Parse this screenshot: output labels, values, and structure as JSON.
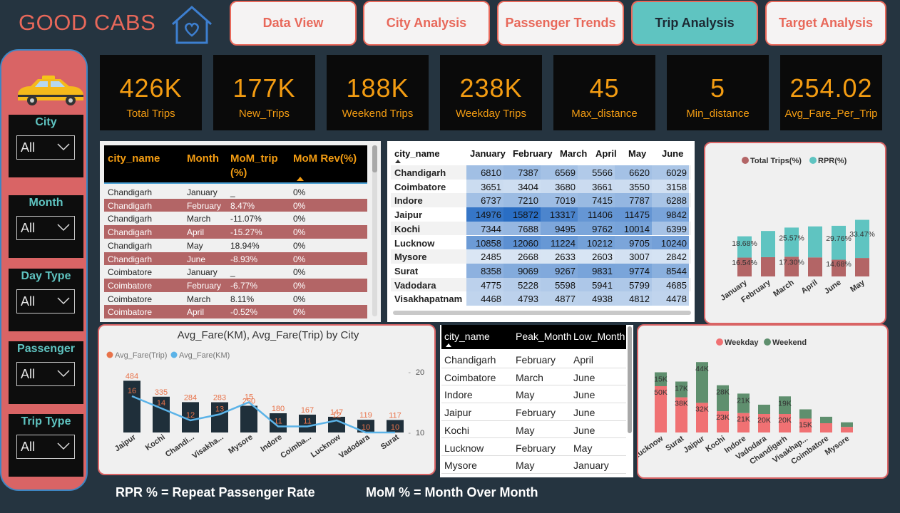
{
  "brand": "GOOD CABS",
  "nav": [
    "Data View",
    "City Analysis",
    "Passenger Trends",
    "Trip Analysis",
    "Target Analysis"
  ],
  "active_nav": "Trip Analysis",
  "filters": [
    {
      "label": "City",
      "value": "All"
    },
    {
      "label": "Month",
      "value": "All"
    },
    {
      "label": "Day Type",
      "value": "All"
    },
    {
      "label": "Passenger",
      "value": "All"
    },
    {
      "label": "Trip Type",
      "value": "All"
    }
  ],
  "kpis": [
    {
      "value": "426K",
      "label": "Total Trips"
    },
    {
      "value": "177K",
      "label": "New_Trips"
    },
    {
      "value": "188K",
      "label": "Weekend Trips"
    },
    {
      "value": "238K",
      "label": "Weekday Trips"
    },
    {
      "value": "45",
      "label": "Max_distance"
    },
    {
      "value": "5",
      "label": "Min_distance"
    },
    {
      "value": "254.02",
      "label": "Avg_Fare_Per_Trip"
    }
  ],
  "mom_table": {
    "headers": [
      "city_name",
      "Month",
      "MoM_trip (%)",
      "MoM Rev(%)"
    ],
    "rows": [
      [
        "Chandigarh",
        "January",
        "_",
        "0%"
      ],
      [
        "Chandigarh",
        "February",
        "8.47%",
        "0%"
      ],
      [
        "Chandigarh",
        "March",
        "-11.07%",
        "0%"
      ],
      [
        "Chandigarh",
        "April",
        "-15.27%",
        "0%"
      ],
      [
        "Chandigarh",
        "May",
        "18.94%",
        "0%"
      ],
      [
        "Chandigarh",
        "June",
        "-8.93%",
        "0%"
      ],
      [
        "Coimbatore",
        "January",
        "_",
        "0%"
      ],
      [
        "Coimbatore",
        "February",
        "-6.77%",
        "0%"
      ],
      [
        "Coimbatore",
        "March",
        "8.11%",
        "0%"
      ],
      [
        "Coimbatore",
        "April",
        "-0.52%",
        "0%"
      ]
    ]
  },
  "heat_table": {
    "headers": [
      "city_name",
      "January",
      "February",
      "March",
      "April",
      "May",
      "June"
    ],
    "rows": [
      [
        "Chandigarh",
        6810,
        7387,
        6569,
        5566,
        6620,
        6029
      ],
      [
        "Coimbatore",
        3651,
        3404,
        3680,
        3661,
        3550,
        3158
      ],
      [
        "Indore",
        6737,
        7210,
        7019,
        7415,
        7787,
        6288
      ],
      [
        "Jaipur",
        14976,
        15872,
        13317,
        11406,
        11475,
        9842
      ],
      [
        "Kochi",
        7344,
        7688,
        9495,
        9762,
        10014,
        6399
      ],
      [
        "Lucknow",
        10858,
        12060,
        11224,
        10212,
        9705,
        10240
      ],
      [
        "Mysore",
        2485,
        2668,
        2633,
        2603,
        3007,
        2842
      ],
      [
        "Surat",
        8358,
        9069,
        9267,
        9831,
        9774,
        8544
      ],
      [
        "Vadodara",
        4775,
        5228,
        5598,
        5941,
        5799,
        4685
      ],
      [
        "Visakhapatnam",
        4468,
        4793,
        4877,
        4938,
        4812,
        4478
      ]
    ]
  },
  "peak_table": {
    "headers": [
      "city_name",
      "Peak_Month",
      "Low_Month"
    ],
    "rows": [
      [
        "Chandigarh",
        "February",
        "April"
      ],
      [
        "Coimbatore",
        "March",
        "June"
      ],
      [
        "Indore",
        "May",
        "June"
      ],
      [
        "Jaipur",
        "February",
        "June"
      ],
      [
        "Kochi",
        "May",
        "June"
      ],
      [
        "Lucknow",
        "February",
        "May"
      ],
      [
        "Mysore",
        "May",
        "January"
      ]
    ]
  },
  "chart_data": [
    {
      "type": "bar",
      "stacked": true,
      "legend": [
        "Total Trips(%)",
        "RPR(%)"
      ],
      "colors": [
        "#b36566",
        "#5fc4c1"
      ],
      "categories": [
        "January",
        "February",
        "March",
        "April",
        "June",
        "May"
      ],
      "series": [
        {
          "name": "Total Trips(%)",
          "values": [
            16.54,
            16.9,
            17.3,
            16.7,
            14.68,
            16.2
          ]
        },
        {
          "name": "RPR(%)",
          "values": [
            18.68,
            23.0,
            25.57,
            27.2,
            29.76,
            33.47
          ]
        }
      ],
      "data_labels": {
        "top": [
          "18.68%",
          "",
          "25.57%",
          "",
          "29.76%",
          "33.47%"
        ],
        "bottom": [
          "16.54%",
          "",
          "17.30%",
          "",
          "14.68%",
          ""
        ]
      }
    },
    {
      "type": "bar+line",
      "title": "Avg_Fare(KM), Avg_Fare(Trip) by City",
      "legend": [
        "Avg_Fare(Trip)",
        "Avg_Fare(KM)"
      ],
      "colors": [
        "#e8734a",
        "#5bb3e8"
      ],
      "categories": [
        "Jaipur",
        "Kochi",
        "Chandi...",
        "Visakha...",
        "Mysore",
        "Indore",
        "Coimba...",
        "Lucknow",
        "Vadodara",
        "Surat"
      ],
      "series": [
        {
          "name": "Avg_Fare(Trip)",
          "values": [
            484,
            335,
            284,
            283,
            250,
            180,
            167,
            147,
            119,
            117
          ]
        },
        {
          "name": "Avg_Fare(KM)",
          "values": [
            16,
            14,
            12,
            13,
            15,
            11,
            11,
            12,
            10,
            10
          ]
        }
      ],
      "y2_ticks": [
        20,
        10
      ]
    },
    {
      "type": "bar",
      "stacked": true,
      "legend": [
        "Weekday",
        "Weekend"
      ],
      "colors": [
        "#f07173",
        "#5f8f6e"
      ],
      "categories": [
        "Lucknow",
        "Surat",
        "Jaipur",
        "Kochi",
        "Indore",
        "Vadodara",
        "Chandigarh",
        "Visakhap...",
        "Coimbatore",
        "Mysore"
      ],
      "series": [
        {
          "name": "Weekday",
          "values": [
            50,
            38,
            32,
            23,
            21,
            20,
            20,
            15,
            10,
            6
          ]
        },
        {
          "name": "Weekend",
          "values": [
            15,
            17,
            44,
            28,
            21,
            10,
            19,
            10,
            7,
            5
          ]
        }
      ],
      "labels_weekday": [
        "50K",
        "38K",
        "32K",
        "23K",
        "21K",
        "20K",
        "20K",
        "15K",
        "",
        ""
      ],
      "labels_weekend": [
        "15K",
        "17K",
        "44K",
        "28K",
        "21K",
        "",
        "19K",
        "",
        "",
        ""
      ]
    }
  ],
  "notes": [
    "RPR % = Repeat Passenger Rate",
    "MoM % = Month Over Month"
  ]
}
